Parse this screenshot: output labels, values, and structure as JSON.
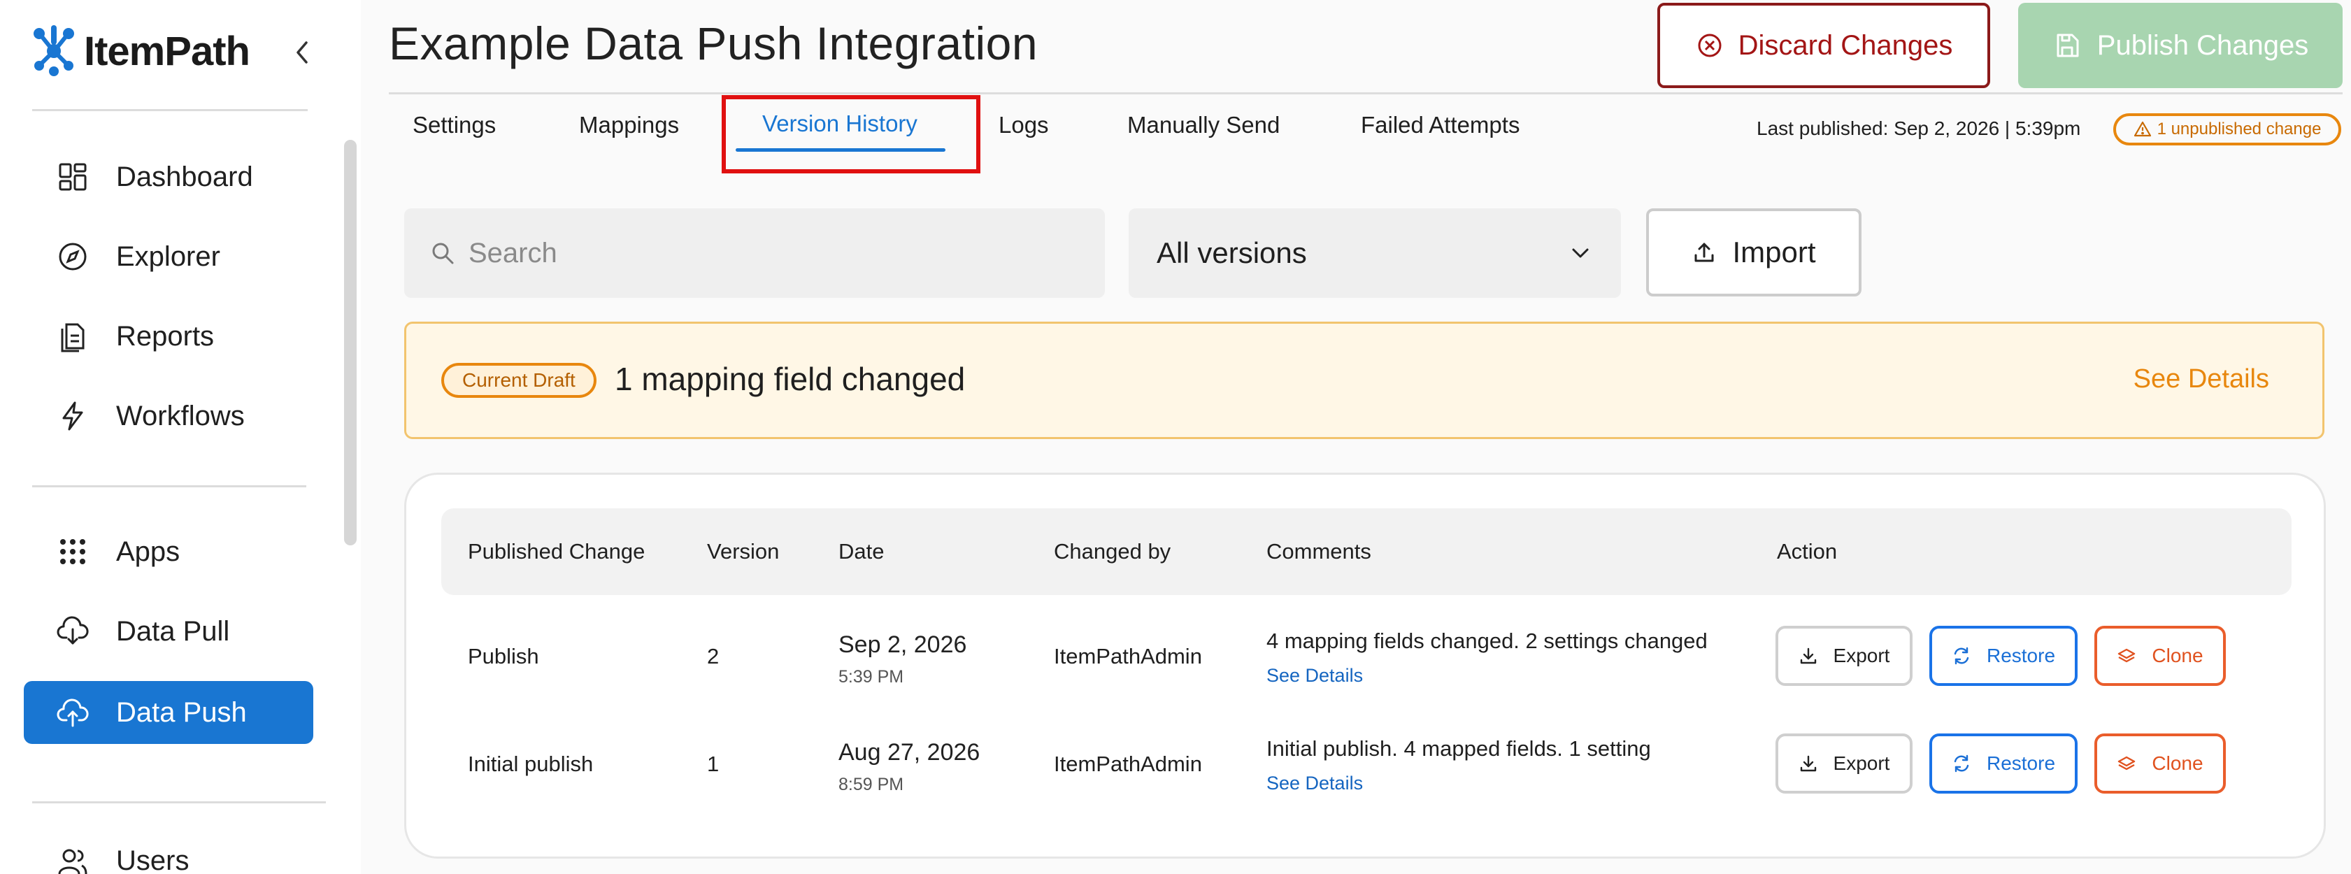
{
  "brand": {
    "name": "ItemPath",
    "color": "#1976d2"
  },
  "sidebar": {
    "primary": [
      {
        "label": "Dashboard",
        "icon": "dashboard-icon"
      },
      {
        "label": "Explorer",
        "icon": "compass-icon"
      },
      {
        "label": "Reports",
        "icon": "reports-icon"
      },
      {
        "label": "Workflows",
        "icon": "lightning-icon"
      }
    ],
    "secondary": [
      {
        "label": "Apps",
        "icon": "apps-grid-icon"
      },
      {
        "label": "Data Pull",
        "icon": "cloud-download-icon"
      },
      {
        "label": "Data Push",
        "icon": "cloud-upload-icon",
        "active": true
      }
    ],
    "tertiary": [
      {
        "label": "Users",
        "icon": "users-icon"
      }
    ],
    "active_color": "#1976d2"
  },
  "header": {
    "title": "Example Data Push Integration",
    "discard_label": "Discard Changes",
    "publish_label": "Publish Changes"
  },
  "tabs": [
    {
      "label": "Settings"
    },
    {
      "label": "Mappings"
    },
    {
      "label": "Version History",
      "active": true
    },
    {
      "label": "Logs"
    },
    {
      "label": "Manually Send"
    },
    {
      "label": "Failed Attempts"
    }
  ],
  "status": {
    "last_published": "Last published: Sep 2, 2026 | 5:39pm",
    "unpublished_badge": "1 unpublished change"
  },
  "toolbar": {
    "search_placeholder": "Search",
    "version_filter": "All versions",
    "import_label": "Import"
  },
  "draft": {
    "badge": "Current Draft",
    "text": "1 mapping field changed",
    "link": "See Details"
  },
  "table": {
    "columns": [
      "Published Change",
      "Version",
      "Date",
      "Changed by",
      "Comments",
      "Action"
    ],
    "rows": [
      {
        "change": "Publish",
        "version": "2",
        "date": "Sep 2, 2026",
        "time": "5:39 PM",
        "changed_by": "ItemPathAdmin",
        "comment": "4 mapping fields changed. 2 settings changed",
        "details_link": "See Details"
      },
      {
        "change": "Initial publish",
        "version": "1",
        "date": "Aug 27, 2026",
        "time": "8:59 PM",
        "changed_by": "ItemPathAdmin",
        "comment": "Initial publish. 4 mapped fields. 1 setting",
        "details_link": "See Details"
      }
    ],
    "actions": {
      "export": "Export",
      "restore": "Restore",
      "clone": "Clone"
    }
  }
}
